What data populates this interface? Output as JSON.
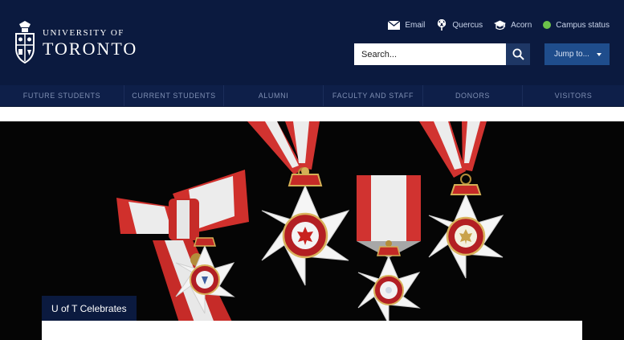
{
  "brand": {
    "line1": "UNIVERSITY OF",
    "line2": "TORONTO"
  },
  "utility": {
    "email": "Email",
    "quercus": "Quercus",
    "acorn": "Acorn",
    "status": "Campus status"
  },
  "search": {
    "placeholder": "Search..."
  },
  "jump": {
    "label": "Jump to..."
  },
  "nav": {
    "items": [
      "FUTURE STUDENTS",
      "CURRENT STUDENTS",
      "ALUMNI",
      "FACULTY AND STAFF",
      "DONORS",
      "VISITORS"
    ]
  },
  "hero": {
    "label": "U of T Celebrates"
  },
  "colors": {
    "header_bg": "#0b1a3f",
    "nav_bg": "#0e1f49",
    "jump_bg": "#1f4d8c",
    "status_green": "#6cc24a"
  },
  "icons": [
    "envelope-icon",
    "quercus-tree-icon",
    "graduation-cap-icon",
    "status-dot-icon",
    "search-icon",
    "chevron-down-icon",
    "crest-icon"
  ]
}
